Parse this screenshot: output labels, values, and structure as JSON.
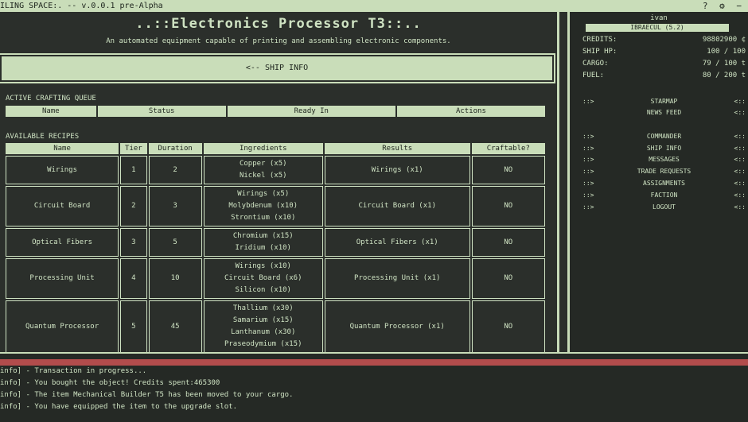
{
  "app": {
    "window_title": "ILING SPACE:. -- v.0.0.1 pre-Alpha",
    "icons": [
      "?",
      "⚙",
      "−"
    ]
  },
  "page": {
    "title": "..::Electronics Processor T3::..",
    "subtitle": "An automated equipment capable of printing and assembling electronic components.",
    "back_button": "<-- SHIP INFO"
  },
  "queue": {
    "label": "ACTIVE CRAFTING QUEUE",
    "columns": [
      "Name",
      "Status",
      "Ready In",
      "Actions"
    ]
  },
  "recipes": {
    "label": "AVAILABLE RECIPES",
    "columns": [
      "Name",
      "Tier",
      "Duration",
      "Ingredients",
      "Results",
      "Craftable?"
    ],
    "rows": [
      {
        "name": "Wirings",
        "tier": "1",
        "duration": "2",
        "ingredients": [
          "Copper (x5)",
          "Nickel (x5)"
        ],
        "results": "Wirings (x1)",
        "craftable": "NO"
      },
      {
        "name": "Circuit Board",
        "tier": "2",
        "duration": "3",
        "ingredients": [
          "Wirings (x5)",
          "Molybdenum (x10)",
          "Strontium (x10)"
        ],
        "results": "Circuit Board (x1)",
        "craftable": "NO"
      },
      {
        "name": "Optical Fibers",
        "tier": "3",
        "duration": "5",
        "ingredients": [
          "Chromium (x15)",
          "Iridium (x10)"
        ],
        "results": "Optical Fibers (x1)",
        "craftable": "NO"
      },
      {
        "name": "Processing Unit",
        "tier": "4",
        "duration": "10",
        "ingredients": [
          "Wirings (x10)",
          "Circuit Board (x6)",
          "Silicon (x10)"
        ],
        "results": "Processing Unit (x1)",
        "craftable": "NO"
      },
      {
        "name": "Quantum Processor",
        "tier": "5",
        "duration": "45",
        "ingredients": [
          "Thallium (x30)",
          "Samarium (x15)",
          "Lanthanum (x30)",
          "Praseodymium (x15)"
        ],
        "results": "Quantum Processor (x1)",
        "craftable": "NO"
      }
    ]
  },
  "side": {
    "user": "ivan",
    "group": "IBRAECUL (5.2)",
    "stats": [
      {
        "label": "CREDITS:",
        "value": "98802900 ¢"
      },
      {
        "label": "SHIP HP:",
        "value": "100 / 100"
      },
      {
        "label": "CARGO:",
        "value": "79 / 100 t"
      },
      {
        "label": "FUEL:",
        "value": "80 / 200 t"
      }
    ],
    "nav": [
      {
        "l": "::>",
        "label": "STARMAP",
        "r": "<::"
      },
      {
        "l": "",
        "label": "NEWS FEED",
        "r": "<::"
      },
      {
        "l": "::>",
        "label": "COMMANDER",
        "r": "<::"
      },
      {
        "l": "::>",
        "label": "SHIP INFO",
        "r": "<::"
      },
      {
        "l": "::>",
        "label": "MESSAGES",
        "r": "<::"
      },
      {
        "l": "::>",
        "label": "TRADE REQUESTS",
        "r": "<::"
      },
      {
        "l": "::>",
        "label": "ASSIGNMENTS",
        "r": "<::"
      },
      {
        "l": "::>",
        "label": "FACTION",
        "r": "<::"
      },
      {
        "l": "::>",
        "label": "LOGOUT",
        "r": "<::"
      }
    ]
  },
  "log": [
    "info] - Transaction in progress...",
    "info] - You bought the object! Credits spent:465300",
    "info] - The item Mechanical Builder T5 has been moved to your cargo.",
    "info] - You have equipped the item to the upgrade slot."
  ]
}
